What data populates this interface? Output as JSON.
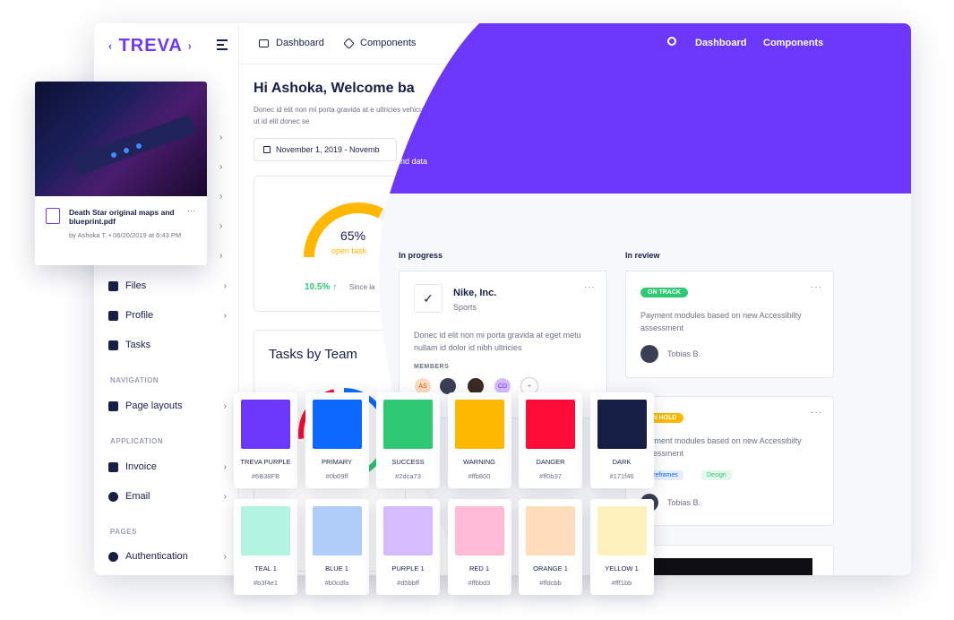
{
  "app": {
    "logo": "TREVA"
  },
  "sidebar": {
    "section_labels": [
      "NAVIGATION",
      "APPLICATION",
      "PAGES"
    ],
    "items": [
      {
        "label": "Files"
      },
      {
        "label": "Profile"
      },
      {
        "label": "Tasks"
      },
      {
        "label": "Page layouts"
      },
      {
        "label": "Invoice"
      },
      {
        "label": "Email"
      },
      {
        "label": "Authentication"
      }
    ]
  },
  "topnav": {
    "dashboard": "Dashboard",
    "components": "Components"
  },
  "overlay_nav": {
    "dashboard": "Dashboard",
    "components": "Components",
    "subtitle": "tion and data"
  },
  "greeting": {
    "title": "Hi Ashoka, Welcome ba",
    "text": "Donec id elit non mi porta gravida at e ultricies vehicula ut id elit donec se",
    "date": "November 1, 2019 - Novemb"
  },
  "gauge": {
    "value": "65%",
    "label": "open task",
    "growth": "10.5%",
    "growth_arrow": "↑",
    "since": "Since la",
    "percent": 65
  },
  "team": {
    "title": "Tasks by Team"
  },
  "columns": {
    "in_progress": "In progress",
    "in_review": "In review"
  },
  "cards": {
    "nike": {
      "title": "Nike, Inc.",
      "subtitle": "Sports",
      "text": "Donec id elit non mi porta gravida at eget metu nullam id dolor id nibh ultricies",
      "members_label": "MEMBERS",
      "members": [
        "AS",
        "",
        "",
        "CD",
        "+"
      ]
    },
    "review1": {
      "badge": "ON TRACK",
      "text": "Payment modules based on new Accessibilty assessment",
      "person": "Tobias B."
    },
    "review2": {
      "badge": "ON HOLD",
      "text": "Payment modules based on new Accessibilty assessment",
      "tags": [
        "Wireframes",
        "Design"
      ],
      "person": "Tobias B."
    }
  },
  "file": {
    "name": "Death Star original maps and blueprint.pdf",
    "meta": "by Ashoka T. • 06/20/2019 at 6:43 PM",
    "menu": "···"
  },
  "swatches": [
    {
      "name": "TREVA PURPLE",
      "hex": "#6B38FB",
      "color": "#6b38fb"
    },
    {
      "name": "PRIMARY",
      "hex": "#0b69ff",
      "color": "#0b69ff"
    },
    {
      "name": "SUCCESS",
      "hex": "#2dca73",
      "color": "#2dca73"
    },
    {
      "name": "WARNING",
      "hex": "#ffb800",
      "color": "#ffb800"
    },
    {
      "name": "DANGER",
      "hex": "#ff0b37",
      "color": "#ff0b37"
    },
    {
      "name": "DARK",
      "hex": "#171f46",
      "color": "#171f46"
    },
    {
      "name": "TEAL 1",
      "hex": "#b3f4e1",
      "color": "#b3f4e1"
    },
    {
      "name": "BLUE 1",
      "hex": "#b0cdfa",
      "color": "#b0cdfa"
    },
    {
      "name": "PURPLE 1",
      "hex": "#d5bbff",
      "color": "#d5bbff"
    },
    {
      "name": "RED 1",
      "hex": "#ffbbd3",
      "color": "#ffbbd3"
    },
    {
      "name": "ORANGE 1",
      "hex": "#ffdcbb",
      "color": "#ffdcbb"
    },
    {
      "name": "YELLOW 1",
      "hex": "#fff1bb",
      "color": "#fff1bb"
    }
  ],
  "colors": {
    "brand": "#6b38fb",
    "success": "#2dca73",
    "warning": "#ffb800",
    "dark": "#171f46"
  }
}
